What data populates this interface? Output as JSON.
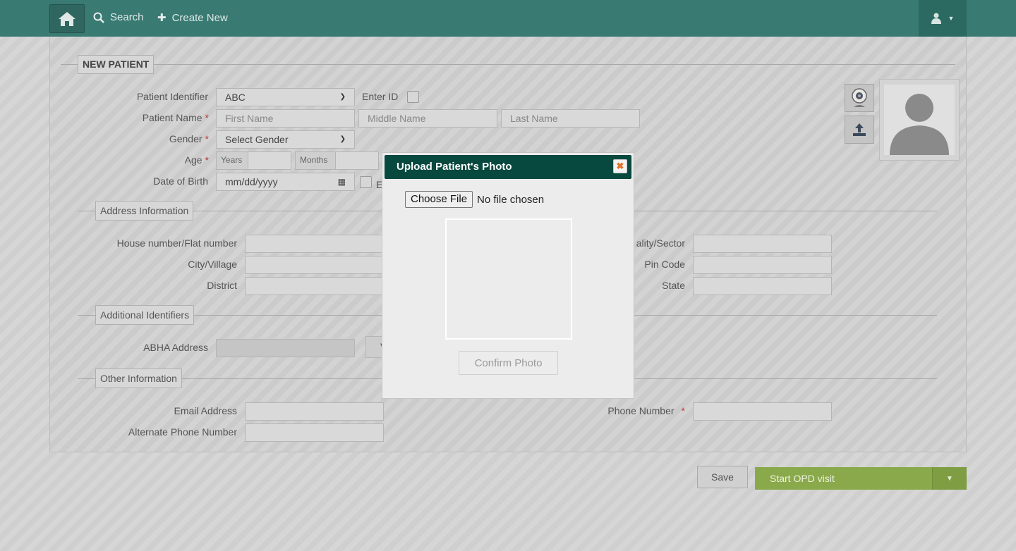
{
  "nav": {
    "search": "Search",
    "create_new": "Create New"
  },
  "form": {
    "title": "NEW PATIENT",
    "patient_identifier_label": "Patient Identifier",
    "patient_identifier_value": "ABC",
    "enter_id_label": "Enter ID",
    "patient_name_label": "Patient Name",
    "required_mark": "*",
    "first_name_placeholder": "First Name",
    "middle_name_placeholder": "Middle Name",
    "last_name_placeholder": "Last Name",
    "gender_label": "Gender",
    "gender_value": "Select Gender",
    "age_label": "Age",
    "years_label": "Years",
    "months_label": "Months",
    "dob_label": "Date of Birth",
    "dob_placeholder": "mm/dd/yyyy",
    "estimated_partial": "E"
  },
  "address": {
    "legend": "Address Information",
    "house_label": "House number/Flat number",
    "locality_label": "ality/Sector",
    "city_label": "City/Village",
    "pin_label": "Pin Code",
    "district_label": "District",
    "state_label": "State"
  },
  "identifiers": {
    "legend": "Additional Identifiers",
    "abha_label": "ABHA Address",
    "verify_partial": "V"
  },
  "other": {
    "legend": "Other Information",
    "email_label": "Email Address",
    "phone_label": "Phone Number",
    "alt_phone_label": "Alternate Phone Number"
  },
  "actions": {
    "save": "Save",
    "start_opd": "Start OPD visit"
  },
  "modal": {
    "title": "Upload Patient's Photo",
    "choose_file": "Choose File",
    "no_file": "No file chosen",
    "confirm": "Confirm Photo"
  },
  "colors": {
    "topbar": "#397a72",
    "modal_header": "#07483f",
    "opd_button": "#8aa94b"
  }
}
